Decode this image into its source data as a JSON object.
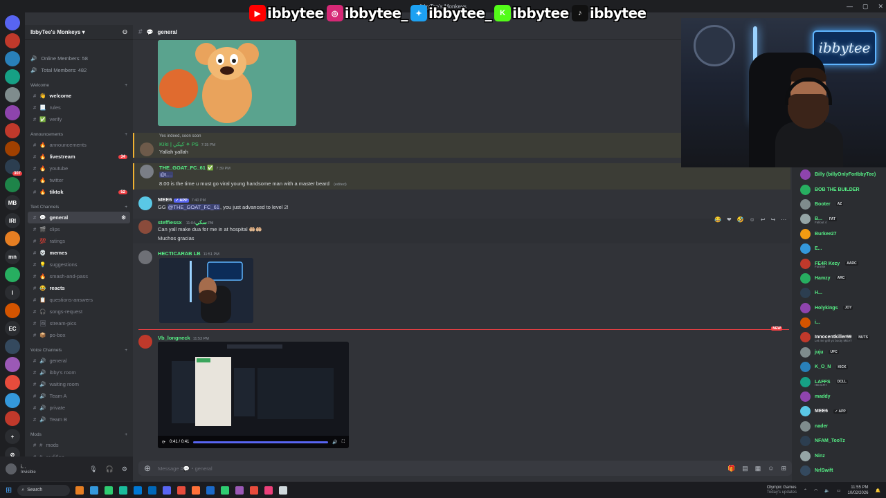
{
  "window": {
    "title": "IbbyTee's Monkeys",
    "controls": [
      "—",
      "▢",
      "✕"
    ]
  },
  "banner": {
    "items": [
      {
        "icon": "youtube-icon",
        "glyph": "▶",
        "color": "#ff0000",
        "name": "ibbytee"
      },
      {
        "icon": "instagram-icon",
        "glyph": "◎",
        "color": "#d62976",
        "name": "ibbytee_"
      },
      {
        "icon": "twitter-icon",
        "glyph": "✦",
        "color": "#1da1f2",
        "name": "ibbytee_"
      },
      {
        "icon": "kick-icon",
        "glyph": "K",
        "color": "#53fc18",
        "name": "ibbytee"
      },
      {
        "icon": "tiktok-icon",
        "glyph": "♪",
        "color": "#111111",
        "name": "ibbytee"
      }
    ]
  },
  "rail": {
    "servers": [
      {
        "label": "",
        "color": "#5865f2",
        "badge": ""
      },
      {
        "label": "",
        "color": "#c0392b",
        "badge": ""
      },
      {
        "label": "",
        "color": "#2980b9",
        "badge": ""
      },
      {
        "label": "",
        "color": "#16a085",
        "badge": ""
      },
      {
        "label": "",
        "color": "#7f8c8d",
        "badge": ""
      },
      {
        "label": "",
        "color": "#8e44ad",
        "badge": ""
      },
      {
        "label": "",
        "color": "#c0392b",
        "badge": ""
      },
      {
        "label": "",
        "color": "#a04000",
        "badge": ""
      },
      {
        "label": "",
        "color": "#2c3e50",
        "badge": "307"
      },
      {
        "label": "",
        "color": "#1e8449",
        "badge": ""
      },
      {
        "label": "MB",
        "color": "#2b2d31",
        "badge": ""
      },
      {
        "label": "IRI",
        "color": "#2b2d31",
        "badge": ""
      },
      {
        "label": "",
        "color": "#e67e22",
        "badge": ""
      },
      {
        "label": "mn",
        "color": "#2b2d31",
        "badge": ""
      },
      {
        "label": "",
        "color": "#27ae60",
        "badge": ""
      },
      {
        "label": "I",
        "color": "#2b2d31",
        "badge": ""
      },
      {
        "label": "",
        "color": "#d35400",
        "badge": ""
      },
      {
        "label": "EC",
        "color": "#2b2d31",
        "badge": ""
      },
      {
        "label": "",
        "color": "#34495e",
        "badge": ""
      },
      {
        "label": "",
        "color": "#9b59b6",
        "badge": ""
      },
      {
        "label": "",
        "color": "#e74c3c",
        "badge": ""
      },
      {
        "label": "",
        "color": "#3498db",
        "badge": ""
      },
      {
        "label": "",
        "color": "#c0392b",
        "badge": ""
      },
      {
        "label": "+",
        "color": "#2b2d31",
        "badge": ""
      },
      {
        "label": "⊘",
        "color": "#2b2d31",
        "badge": ""
      }
    ]
  },
  "guild": {
    "name": "IbbyTee's Monkeys ▾"
  },
  "sidebar": {
    "stats": [
      {
        "label": "Online Members: 58"
      },
      {
        "label": "Total Members: 482"
      }
    ],
    "categories": [
      {
        "name": "Welcome",
        "channels": [
          {
            "icon": "👋",
            "name": "welcome",
            "state": "unread",
            "count": ""
          },
          {
            "icon": "📃",
            "name": "rules",
            "state": "",
            "count": ""
          },
          {
            "icon": "✅",
            "name": "verify",
            "state": "",
            "count": ""
          }
        ]
      },
      {
        "name": "Announcements",
        "channels": [
          {
            "icon": "🔥",
            "name": "announcements",
            "state": "",
            "count": ""
          },
          {
            "icon": "🔥",
            "name": "livestream",
            "state": "unread",
            "count": "34"
          },
          {
            "icon": "🔥",
            "name": "youtube",
            "state": "",
            "count": ""
          },
          {
            "icon": "🔥",
            "name": "twitter",
            "state": "",
            "count": ""
          },
          {
            "icon": "🔥",
            "name": "tiktok",
            "state": "unread",
            "count": "52"
          }
        ]
      },
      {
        "name": "Text Channels",
        "channels": [
          {
            "icon": "💬",
            "name": "general",
            "state": "active",
            "count": ""
          },
          {
            "icon": "🎬",
            "name": "clips",
            "state": "",
            "count": ""
          },
          {
            "icon": "💯",
            "name": "ratings",
            "state": "",
            "count": ""
          },
          {
            "icon": "💀",
            "name": "memes",
            "state": "unread",
            "count": ""
          },
          {
            "icon": "💡",
            "name": "suggestions",
            "state": "",
            "count": ""
          },
          {
            "icon": "🔥",
            "name": "smash-and-pass",
            "state": "",
            "count": ""
          },
          {
            "icon": "😂",
            "name": "reacts",
            "state": "unread",
            "count": ""
          },
          {
            "icon": "📋",
            "name": "questions-answers",
            "state": "",
            "count": ""
          },
          {
            "icon": "🎧",
            "name": "songs-request",
            "state": "",
            "count": ""
          },
          {
            "icon": "🖼",
            "name": "stream-pics",
            "state": "",
            "count": ""
          },
          {
            "icon": "📦",
            "name": "po-box",
            "state": "",
            "count": ""
          }
        ]
      },
      {
        "name": "Voice Channels",
        "channels": [
          {
            "icon": "🔊",
            "name": "general",
            "state": "",
            "count": ""
          },
          {
            "icon": "🔊",
            "name": "ibby's room",
            "state": "",
            "count": ""
          },
          {
            "icon": "🔊",
            "name": "waiting room",
            "state": "",
            "count": ""
          },
          {
            "icon": "🔊",
            "name": "Team A",
            "state": "",
            "count": ""
          },
          {
            "icon": "🔊",
            "name": "private",
            "state": "",
            "count": ""
          },
          {
            "icon": "🔊",
            "name": "Team B",
            "state": "",
            "count": ""
          }
        ]
      },
      {
        "name": "Mods",
        "channels": [
          {
            "icon": "#",
            "name": "mods",
            "state": "",
            "count": ""
          },
          {
            "icon": "#",
            "name": "auditlog",
            "state": "",
            "count": ""
          }
        ]
      }
    ]
  },
  "user_panel": {
    "name": "i...",
    "status": "Invisible"
  },
  "chat": {
    "channel": "general",
    "messages": [
      {
        "reply": "Yes indeed, soon soon",
        "user": "Kiki | كيكي ✦ PS",
        "user_color": "#3ba55c",
        "time": "7:35 PM",
        "text": "Yallah yallah",
        "highlight": true,
        "avatar": "#6d5a4a"
      },
      {
        "user": "THE_GOAT_FC_61 ✅",
        "user_color": "#57f287",
        "time": "7:39 PM",
        "text": "8.00 is the time u must go viral young handsome man with a master beard",
        "edited": "(edited)",
        "highlight": true,
        "avatar": "#7a7e86",
        "mention_line": "@L..."
      },
      {
        "user": "MEE6",
        "app": "✓ APP",
        "user_color": "#f2f3f5",
        "time": "7:40 PM",
        "text_pre": "GG ",
        "mention": "@THE_GOAT_FC_61",
        "text": ", you just advanced to level 2!",
        "highlight": false,
        "avatar": "#5ac8e6"
      },
      {
        "user": "steffiessx سكي",
        "user_color": "#57f287",
        "time": "11:04 PM",
        "text": "Can yall make dua for me in at hospital 🤲🏼🤲🏼",
        "text2": "Muchos gracias",
        "highlight": false,
        "avatar": "#8a4b3b"
      },
      {
        "user": "HECTICARAB LB",
        "user_color": "#57f287",
        "time": "11:51 PM",
        "text": "",
        "highlight": false,
        "avatar": "#6e7076"
      },
      {
        "user": "Vb_longneck",
        "user_color": "#57f287",
        "time": "11:53 PM",
        "text": "",
        "highlight": false,
        "avatar": "#c0392b"
      }
    ],
    "new_marker": "NEW",
    "video": {
      "time": "0:41 / 0:41"
    },
    "composer_placeholder": "Message #💬・general"
  },
  "members": [
    {
      "name": "Billy (billyOnlyForIbbyTee)",
      "color": "#57f287",
      "tag": "",
      "sub": "",
      "avatar": "#8e44ad"
    },
    {
      "name": "BOB THE BUILDER",
      "color": "#57f287",
      "tag": "",
      "sub": "",
      "avatar": "#27ae60"
    },
    {
      "name": "Booter",
      "color": "#57f287",
      "tag": "AZ",
      "sub": "",
      "avatar": "#7f8c8d"
    },
    {
      "name": "B...",
      "color": "#57f287",
      "tag": "FAT",
      "sub": "Fallout 4",
      "avatar": "#95a5a6"
    },
    {
      "name": "Burkee27",
      "color": "#57f287",
      "tag": "",
      "sub": "",
      "avatar": "#f39c12"
    },
    {
      "name": "E...",
      "color": "#57f287",
      "tag": "",
      "sub": "",
      "avatar": "#3498db"
    },
    {
      "name": "FE4R Kezy",
      "color": "#57f287",
      "tag": "AARC",
      "sub": "Fortnite",
      "avatar": "#c0392b"
    },
    {
      "name": "Hamzy",
      "color": "#57f287",
      "tag": "ARC",
      "sub": "",
      "avatar": "#27ae60"
    },
    {
      "name": "H...",
      "color": "#57f287",
      "tag": "",
      "sub": "",
      "avatar": "#2c3e50"
    },
    {
      "name": "Holykings",
      "color": "#57f287",
      "tag": "JOY",
      "sub": "",
      "avatar": "#8e44ad"
    },
    {
      "name": "i...",
      "color": "#57f287",
      "tag": "",
      "sub": "",
      "avatar": "#d35400"
    },
    {
      "name": "Innocentkiller69",
      "color": "#ffffff",
      "tag": "NUTS",
      "sub": "Let me grill yo booty MEAT",
      "avatar": "#c0392b"
    },
    {
      "name": "juju",
      "color": "#57f287",
      "tag": "UFC",
      "sub": "",
      "avatar": "#7f8c8d"
    },
    {
      "name": "K_O_N",
      "color": "#57f287",
      "tag": "KICK",
      "sub": "",
      "avatar": "#2980b9"
    },
    {
      "name": "LAFFS",
      "color": "#57f287",
      "tag": "DCLL",
      "sub": "HEALTH",
      "avatar": "#16a085"
    },
    {
      "name": "maddy",
      "color": "#57f287",
      "tag": "",
      "sub": "",
      "avatar": "#8e44ad"
    },
    {
      "name": "MEE6",
      "color": "#f2f3f5",
      "tag": "✓ APP",
      "sub": "",
      "avatar": "#5ac8e6"
    },
    {
      "name": "nader",
      "color": "#57f287",
      "tag": "",
      "sub": "",
      "avatar": "#7f8c8d"
    },
    {
      "name": "NFAM_TooTz",
      "color": "#57f287",
      "tag": "",
      "sub": "",
      "avatar": "#2c3e50"
    },
    {
      "name": "Ninz",
      "color": "#57f287",
      "tag": "",
      "sub": "",
      "avatar": "#95a5a6"
    },
    {
      "name": "NrlSwift",
      "color": "#57f287",
      "tag": "",
      "sub": "",
      "avatar": "#34495e"
    }
  ],
  "taskbar": {
    "search": "Search",
    "apps": [
      "#e67e22",
      "#3498db",
      "#2ecc71",
      "#1abc9c",
      "#0078d4",
      "#0067b8",
      "#5865f2",
      "#e74c3c",
      "#ff7139",
      "#1b6ac9",
      "#2ecc71",
      "#9b59b6",
      "#e74c3c",
      "#ec407a",
      "#cfd8dc"
    ],
    "notification_title": "Olympic Games",
    "notification_sub": "Today's updates",
    "time": "11:55 PM",
    "date": "10/02/2026"
  }
}
